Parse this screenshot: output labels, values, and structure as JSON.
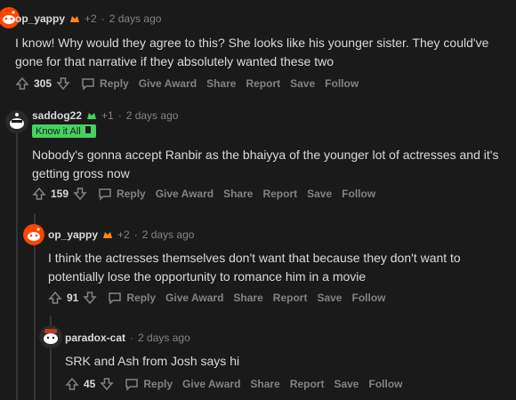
{
  "comments": [
    {
      "username": "op_yappy",
      "karma": "+2",
      "time": "2 days ago",
      "text": "I know! Why would they agree to this? She looks like his younger sister. They could've gone for that narrative if they absolutely wanted these two",
      "votes": "305",
      "actions": [
        "Reply",
        "Give Award",
        "Share",
        "Report",
        "Save",
        "Follow"
      ]
    },
    {
      "username": "saddog22",
      "karma": "+1",
      "time": "2 days ago",
      "flair": "Know it All",
      "text": "Nobody's gonna accept Ranbir as the bhaiyya of the younger lot of actresses and it's getting gross now",
      "votes": "159",
      "actions": [
        "Reply",
        "Give Award",
        "Share",
        "Report",
        "Save",
        "Follow"
      ]
    },
    {
      "username": "op_yappy",
      "karma": "+2",
      "time": "2 days ago",
      "text": "I think the actresses themselves don't want that because they don't want to potentially lose the opportunity to romance him in a movie",
      "votes": "91",
      "actions": [
        "Reply",
        "Give Award",
        "Share",
        "Report",
        "Save",
        "Follow"
      ]
    },
    {
      "username": "paradox-cat",
      "time": "2 days ago",
      "text": "SRK and Ash from Josh says hi",
      "votes": "45",
      "actions": [
        "Reply",
        "Give Award",
        "Share",
        "Report",
        "Save",
        "Follow"
      ]
    }
  ],
  "separator": "·",
  "colors": {
    "background": "#1a1a1b",
    "text": "#d7dadc",
    "meta": "#818384",
    "flair_bg": "#46d160"
  }
}
